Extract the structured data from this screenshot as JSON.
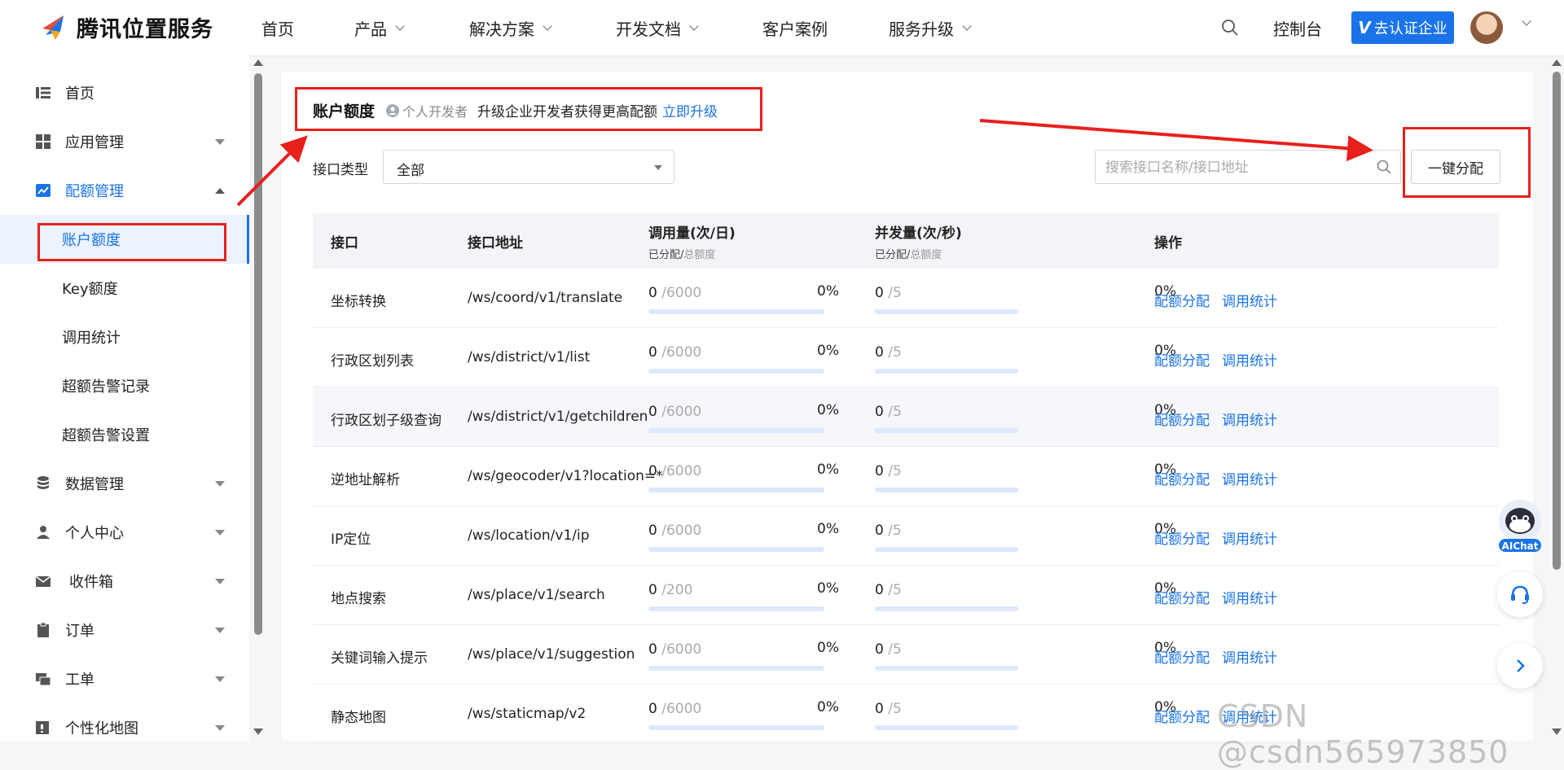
{
  "header": {
    "brand": "腾讯位置服务",
    "nav": [
      {
        "label": "首页"
      },
      {
        "label": "产品"
      },
      {
        "label": "解决方案"
      },
      {
        "label": "开发文档"
      },
      {
        "label": "客户案例"
      },
      {
        "label": "服务升级"
      }
    ],
    "console": "控制台",
    "verify_icon": "V",
    "verify_label": "去认证企业"
  },
  "sidebar": {
    "items": [
      {
        "label": "首页",
        "icon": "list-icon"
      },
      {
        "label": "应用管理",
        "icon": "grid-icon"
      },
      {
        "label": "配额管理",
        "icon": "chart-icon"
      },
      {
        "label": "数据管理",
        "icon": "database-icon"
      },
      {
        "label": "个人中心",
        "icon": "user-icon"
      },
      {
        "label": "收件箱",
        "icon": "mail-icon"
      },
      {
        "label": "订单",
        "icon": "clipboard-icon"
      },
      {
        "label": "工单",
        "icon": "ticket-icon"
      },
      {
        "label": "个性化地图",
        "icon": "map-style-icon"
      }
    ],
    "quota_sub": [
      {
        "label": "账户额度"
      },
      {
        "label": "Key额度"
      },
      {
        "label": "调用统计"
      },
      {
        "label": "超额告警记录"
      },
      {
        "label": "超额告警设置"
      }
    ]
  },
  "main": {
    "title": "账户额度",
    "dev_badge": "个人开发者",
    "upgrade_text": "升级企业开发者获得更高配额",
    "upgrade_link": "立即升级",
    "filter_label": "接口类型",
    "filter_value": "全部",
    "search_placeholder": "搜索接口名称/接口地址",
    "alloc_button": "一键分配",
    "columns": {
      "api": "接口",
      "path": "接口地址",
      "calls": "调用量(次/日)",
      "calls_sub_a": "已分配/",
      "calls_sub_b": "总额度",
      "conc": "并发量(次/秒)",
      "conc_sub_a": "已分配/",
      "conc_sub_b": "总额度",
      "ops": "操作"
    },
    "rows": [
      {
        "name": "坐标转换",
        "path": "/ws/coord/v1/translate",
        "calls_used": "0",
        "calls_total": "/6000",
        "calls_pct": "0%",
        "calls_progress": 0,
        "conc_used": "0",
        "conc_total": "/5",
        "conc_pct": "0%",
        "conc_progress": 0,
        "op1": "配额分配",
        "op2": "调用统计"
      },
      {
        "name": "行政区划列表",
        "path": "/ws/district/v1/list",
        "calls_used": "0",
        "calls_total": "/6000",
        "calls_pct": "0%",
        "calls_progress": 0,
        "conc_used": "0",
        "conc_total": "/5",
        "conc_pct": "0%",
        "conc_progress": 0,
        "op1": "配额分配",
        "op2": "调用统计"
      },
      {
        "name": "行政区划子级查询",
        "path": "/ws/district/v1/getchildren",
        "calls_used": "0",
        "calls_total": "/6000",
        "calls_pct": "0%",
        "calls_progress": 0,
        "conc_used": "0",
        "conc_total": "/5",
        "conc_pct": "0%",
        "conc_progress": 0,
        "op1": "配额分配",
        "op2": "调用统计"
      },
      {
        "name": "逆地址解析",
        "path": "/ws/geocoder/v1?location=*",
        "calls_used": "0",
        "calls_total": "/6000",
        "calls_pct": "0%",
        "calls_progress": 0,
        "conc_used": "0",
        "conc_total": "/5",
        "conc_pct": "0%",
        "conc_progress": 0,
        "op1": "配额分配",
        "op2": "调用统计"
      },
      {
        "name": "IP定位",
        "path": "/ws/location/v1/ip",
        "calls_used": "0",
        "calls_total": "/6000",
        "calls_pct": "0%",
        "calls_progress": 0,
        "conc_used": "0",
        "conc_total": "/5",
        "conc_pct": "0%",
        "conc_progress": 0,
        "op1": "配额分配",
        "op2": "调用统计"
      },
      {
        "name": "地点搜索",
        "path": "/ws/place/v1/search",
        "calls_used": "0",
        "calls_total": "/200",
        "calls_pct": "0%",
        "calls_progress": 0,
        "conc_used": "0",
        "conc_total": "/5",
        "conc_pct": "0%",
        "conc_progress": 0,
        "op1": "配额分配",
        "op2": "调用统计"
      },
      {
        "name": "关键词输入提示",
        "path": "/ws/place/v1/suggestion",
        "calls_used": "0",
        "calls_total": "/6000",
        "calls_pct": "0%",
        "calls_progress": 0,
        "conc_used": "0",
        "conc_total": "/5",
        "conc_pct": "0%",
        "conc_progress": 0,
        "op1": "配额分配",
        "op2": "调用统计"
      },
      {
        "name": "静态地图",
        "path": "/ws/staticmap/v2",
        "calls_used": "0",
        "calls_total": "/6000",
        "calls_pct": "0%",
        "calls_progress": 0,
        "conc_used": "0",
        "conc_total": "/5",
        "conc_pct": "0%",
        "conc_progress": 0,
        "op1": "配额分配",
        "op2": "调用统计"
      }
    ]
  },
  "floating": {
    "aichat_label": "AIChat"
  },
  "watermark": "CSDN @csdn565973850",
  "colors": {
    "accent": "#1a73e8",
    "annotation": "#e8201c",
    "progress_track": "#dce8fb"
  }
}
